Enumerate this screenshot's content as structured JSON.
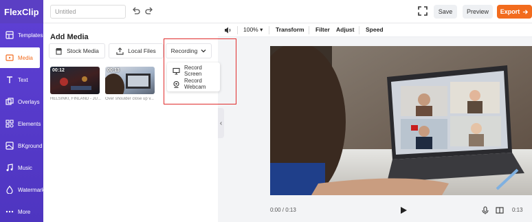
{
  "app": {
    "logo": "FlexClip",
    "title_placeholder": "Untitled"
  },
  "topbar": {
    "save_label": "Save",
    "preview_label": "Preview",
    "export_label": "Export"
  },
  "sidebar": {
    "items": [
      {
        "label": "Templates",
        "icon": "templates-icon"
      },
      {
        "label": "Media",
        "icon": "media-icon",
        "active": true
      },
      {
        "label": "Text",
        "icon": "text-icon"
      },
      {
        "label": "Overlays",
        "icon": "overlays-icon"
      },
      {
        "label": "Elements",
        "icon": "elements-icon"
      },
      {
        "label": "BKground",
        "icon": "background-icon"
      },
      {
        "label": "Music",
        "icon": "music-icon"
      },
      {
        "label": "Watermark",
        "icon": "watermark-icon"
      },
      {
        "label": "More",
        "icon": "more-icon"
      }
    ]
  },
  "panel": {
    "title": "Add Media",
    "tabs": {
      "stock": "Stock Media",
      "local": "Local Files",
      "recording": "Recording"
    },
    "thumbnails": [
      {
        "duration": "00:12",
        "caption": "HELSINKI, FINLAND - JU..."
      },
      {
        "duration": "00:13",
        "caption": "Over shoulder close up v..."
      }
    ],
    "dropdown": {
      "record_screen": "Record Screen",
      "record_webcam": "Record Webcam"
    }
  },
  "editor": {
    "toolbar": {
      "zoom": "100%",
      "transform": "Transform",
      "filter": "Filter",
      "adjust": "Adjust",
      "speed": "Speed"
    },
    "controls": {
      "time": "0:00 / 0:13",
      "time_right": "0:13"
    }
  },
  "colors": {
    "brand_purple": "#5b3fc4",
    "accent_orange": "#f26b1d",
    "highlight_red": "#e02a2a"
  }
}
